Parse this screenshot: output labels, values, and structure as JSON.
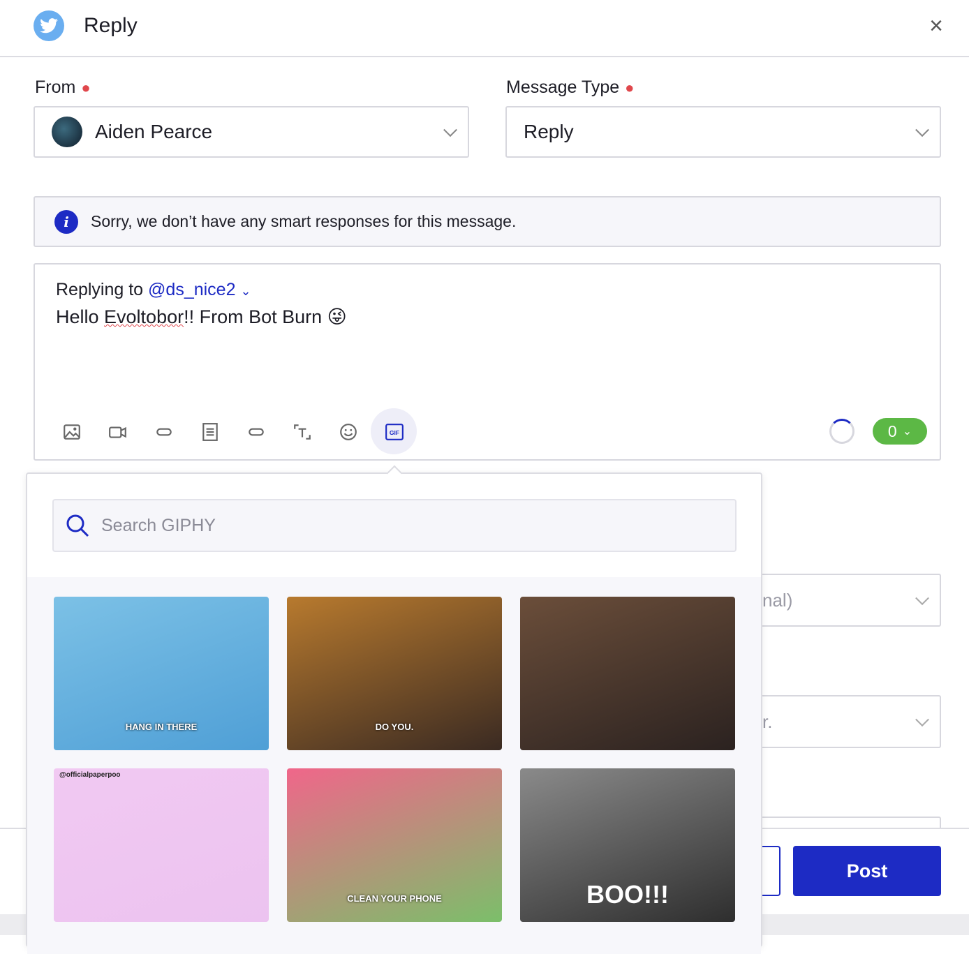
{
  "header": {
    "title": "Reply",
    "close_label": "×",
    "icon": "twitter-bird-icon"
  },
  "from": {
    "label": "From",
    "value": "Aiden Pearce"
  },
  "message_type": {
    "label": "Message Type",
    "value": "Reply"
  },
  "info": {
    "text": "Sorry, we don’t have any smart responses for this message."
  },
  "compose": {
    "replying_prefix": "Replying to",
    "handle": "@ds_nice2",
    "text_before": "Hello ",
    "text_misspelled": "Evoltobor",
    "text_after": "!! From Bot Burn 😜",
    "toolbar": [
      "image-icon",
      "video-icon",
      "link-icon",
      "document-icon",
      "link-icon",
      "text-frame-icon",
      "emoji-icon",
      "gif-icon"
    ],
    "gif_label": "GIF",
    "counter": "0"
  },
  "giphy": {
    "placeholder": "Search GIPHY",
    "tiles": [
      {
        "name": "gif-hang-in-there",
        "text": "HANG IN THERE",
        "colors": [
          "#7cc1e6",
          "#4f9fd6"
        ]
      },
      {
        "name": "gif-do-you",
        "text": "DO YOU.",
        "colors": [
          "#b87a2e",
          "#3a2a22"
        ]
      },
      {
        "name": "gif-woman-eating",
        "text": "",
        "colors": [
          "#6b4e3a",
          "#2b2220"
        ]
      },
      {
        "name": "gif-toilet-paper",
        "text": "@officialpaperpoo",
        "colors": [
          "#f1c9f2",
          "#ecc3f0"
        ]
      },
      {
        "name": "gif-clean-your-phone",
        "text": "CLEAN YOUR PHONE",
        "colors": [
          "#f0668a",
          "#7bbf6a"
        ]
      },
      {
        "name": "gif-boo",
        "text": "BOO!!!",
        "colors": [
          "#8a8a8a",
          "#2e2e2e"
        ]
      }
    ]
  },
  "background": {
    "field1_partial": "nal)",
    "field2_partial": "r."
  },
  "footer": {
    "post_label": "Post"
  },
  "colors": {
    "accent": "#1d2bc4",
    "success": "#5cb845",
    "required": "#e0474c"
  }
}
